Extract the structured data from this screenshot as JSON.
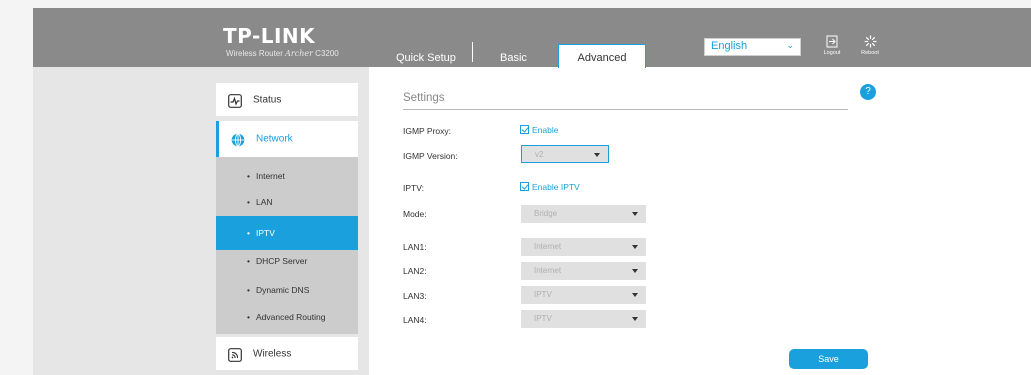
{
  "header": {
    "logo": "TP-LINK",
    "model_prefix": "Wireless Router",
    "model_name": "Archer",
    "model_number": "C3200",
    "tabs": [
      {
        "label": "Quick Setup"
      },
      {
        "label": "Basic"
      },
      {
        "label": "Advanced",
        "active": true
      }
    ],
    "language": "English",
    "logout_label": "Logout",
    "reboot_label": "Reboot"
  },
  "sidebar": {
    "status": {
      "label": "Status",
      "icon": "status-icon"
    },
    "network": {
      "label": "Network",
      "icon": "globe-icon",
      "active": true
    },
    "network_items": [
      {
        "label": "Internet"
      },
      {
        "label": "LAN"
      },
      {
        "label": "IPTV",
        "active": true
      },
      {
        "label": "DHCP Server"
      },
      {
        "label": "Dynamic DNS"
      },
      {
        "label": "Advanced Routing"
      }
    ],
    "wireless": {
      "label": "Wireless",
      "icon": "wireless-icon"
    }
  },
  "main": {
    "section_title": "Settings",
    "help_label": "?",
    "igmp_proxy": {
      "label": "IGMP Proxy:",
      "check_label": "Enable",
      "checked": true
    },
    "igmp_version": {
      "label": "IGMP Version:",
      "value": "v2"
    },
    "iptv": {
      "label": "IPTV:",
      "check_label": "Enable IPTV",
      "checked": true
    },
    "mode": {
      "label": "Mode:",
      "value": "Bridge"
    },
    "lan1": {
      "label": "LAN1:",
      "value": "Internet"
    },
    "lan2": {
      "label": "LAN2:",
      "value": "Internet"
    },
    "lan3": {
      "label": "LAN3:",
      "value": "IPTV"
    },
    "lan4": {
      "label": "LAN4:",
      "value": "IPTV"
    },
    "save_label": "Save"
  },
  "colors": {
    "accent": "#1aa0dc",
    "header": "#8a8a8a",
    "sidebar": "#e6e6e6"
  }
}
